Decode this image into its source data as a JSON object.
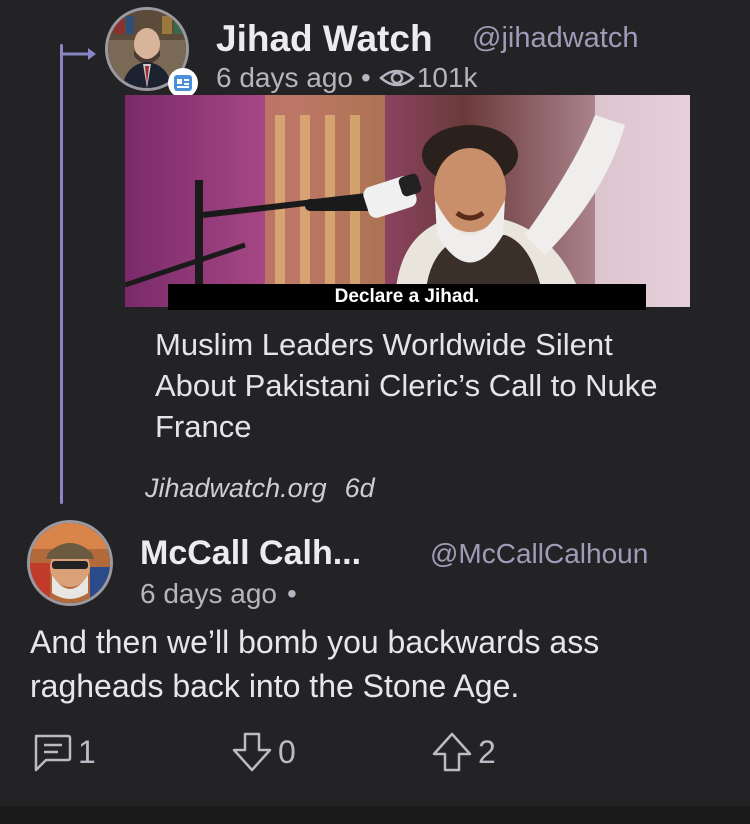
{
  "quoted_post": {
    "author_name": "Jihad Watch",
    "author_handle": "@jihadwatch",
    "time_ago": "6 days ago",
    "separator": "•",
    "view_count": "101k",
    "image_caption": "Declare a Jihad.",
    "headline": "Muslim Leaders Worldwide Silent About Pakistani Cleric’s Call to Nuke France",
    "source_domain": "Jihadwatch.org",
    "source_age": "6d"
  },
  "reply": {
    "author_name": "McCall Calh...",
    "author_handle": "@McCallCalhoun",
    "time_ago": "6 days ago",
    "separator": "•",
    "body": "And then we’ll bomb you backwards ass ragheads back into the Stone Age."
  },
  "actions": {
    "comments": "1",
    "downvotes": "0",
    "upvotes": "2"
  },
  "icons": [
    "verified-badge-icon",
    "eye-icon",
    "comment-icon",
    "downvote-icon",
    "upvote-icon"
  ],
  "colors": {
    "background": "#232224",
    "thread_line": "#8a86c4",
    "handle": "#9f9bb8",
    "badge": "#4a90d9"
  }
}
